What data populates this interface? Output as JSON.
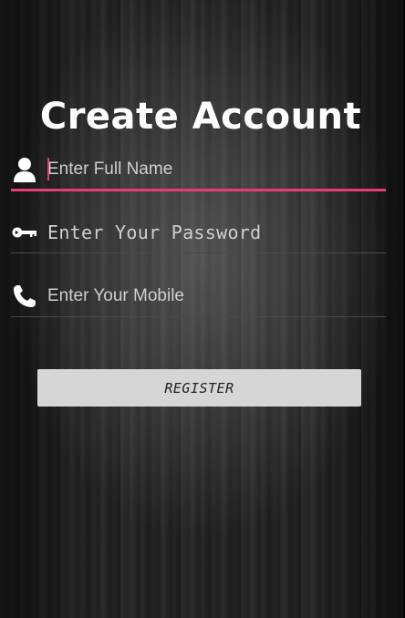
{
  "page": {
    "title": "Create Account"
  },
  "form": {
    "full_name": {
      "icon": "person-icon",
      "placeholder": "Enter Full Name",
      "value": ""
    },
    "password": {
      "icon": "key-icon",
      "placeholder": "Enter Your Password",
      "value": ""
    },
    "mobile": {
      "icon": "phone-icon",
      "placeholder": "Enter Your Mobile",
      "value": ""
    },
    "register_label": "REGISTER"
  },
  "colors": {
    "accent": "#e43f73",
    "button_bg": "#d6d6d6",
    "text": "#ffffff"
  }
}
